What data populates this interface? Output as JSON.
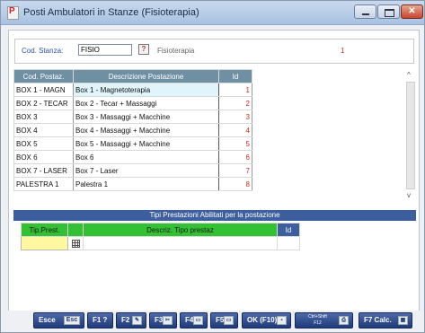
{
  "window": {
    "title": "Posti Ambulatori in Stanze (Fisioterapia)",
    "close_glyph": "✕"
  },
  "stanza": {
    "label": "Cod. Stanza:",
    "code_value": "FISIO",
    "lookup_glyph": "?",
    "description": "Fisioterapia",
    "number": "1"
  },
  "grid_postazioni": {
    "headers": [
      "Cod. Postaz.",
      "Descrizione Postazione",
      "Id"
    ],
    "rows": [
      {
        "code": "BOX 1 - MAGN",
        "desc": "Box 1 - Magnetoterapia",
        "id": "1"
      },
      {
        "code": "BOX 2 - TECAR",
        "desc": "Box 2 - Tecar + Massaggi",
        "id": "2"
      },
      {
        "code": "BOX 3",
        "desc": "Box 3 - Massaggi + Macchine",
        "id": "3"
      },
      {
        "code": "BOX 4",
        "desc": "Box 4 - Massaggi + Macchine",
        "id": "4"
      },
      {
        "code": "BOX 5",
        "desc": "Box 5 - Massaggi + Macchine",
        "id": "5"
      },
      {
        "code": "BOX 6",
        "desc": "Box 6",
        "id": "6"
      },
      {
        "code": "BOX 7 - LASER",
        "desc": "Box 7 - Laser",
        "id": "7"
      },
      {
        "code": "PALESTRA 1",
        "desc": "Palestra 1",
        "id": "8"
      }
    ],
    "scroll_up": "^",
    "scroll_down": "v"
  },
  "grid_prestazioni": {
    "title": "Tipi Prestazioni Abilitati per la postazione",
    "headers": [
      "Tip.Prest.",
      "",
      "Descriz. Tipo prestaz",
      "Id"
    ]
  },
  "toolbar": {
    "esc_label": "Esce",
    "esc_key": "Esc",
    "f1_label": "F1 ?",
    "f2_label": "F2",
    "f3_label": "F3",
    "f4_label": "F4",
    "f5_label": "F5",
    "ok_label": "OK (F10)",
    "ctrl_label_1": "Ctrl+Shift",
    "ctrl_label_2": "F12",
    "f7_label": "F7 Calc."
  },
  "colors": {
    "header_blue": "#6f8fa3",
    "section_bar": "#3d5f9e",
    "green_header": "#33c133",
    "id_red": "#d02a1e",
    "button_blue": "#1f3a7a"
  }
}
